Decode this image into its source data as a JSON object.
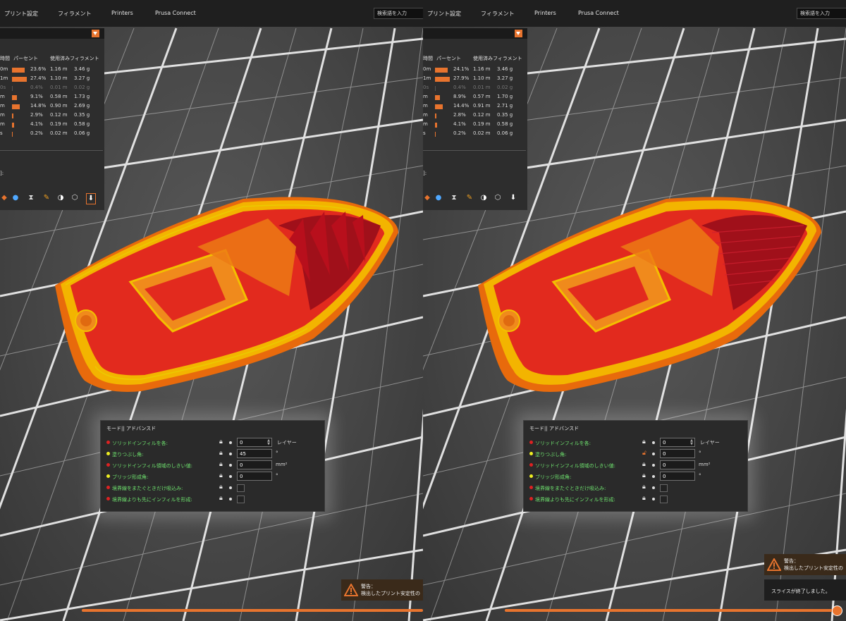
{
  "topbar": {
    "tabs": [
      "プリント設定",
      "フィラメント",
      "Printers",
      "Prusa Connect"
    ],
    "search_placeholder": "検索語を入力"
  },
  "colors": {
    "accent": "#e8742e",
    "label_green": "#6ee26e",
    "infill_red": "#e0202a",
    "perimeter_orange": "#f07a14"
  },
  "left": {
    "stats": {
      "headers": {
        "time": "時間",
        "percent": "パーセント",
        "filament": "使用済みフィラメント"
      },
      "rows": [
        {
          "time": "0m",
          "percent": "23.6%",
          "length": "1.16 m",
          "weight": "3.46 g",
          "bar": 0.236,
          "dim": false
        },
        {
          "time": "1m",
          "percent": "27.4%",
          "length": "1.10 m",
          "weight": "3.27 g",
          "bar": 0.274,
          "dim": false
        },
        {
          "time": "0s",
          "percent": "0.4%",
          "length": "0.01 m",
          "weight": "0.02 g",
          "bar": 0.004,
          "dim": true
        },
        {
          "time": "m",
          "percent": "9.1%",
          "length": "0.58 m",
          "weight": "1.73 g",
          "bar": 0.091,
          "dim": false
        },
        {
          "time": "m",
          "percent": "14.8%",
          "length": "0.90 m",
          "weight": "2.69 g",
          "bar": 0.148,
          "dim": false
        },
        {
          "time": "m",
          "percent": "2.9%",
          "length": "0.12 m",
          "weight": "0.35 g",
          "bar": 0.029,
          "dim": false
        },
        {
          "time": "m",
          "percent": "4.1%",
          "length": "0.19 m",
          "weight": "0.58 g",
          "bar": 0.041,
          "dim": false
        },
        {
          "time": "s",
          "percent": "0.2%",
          "length": "0.02 m",
          "weight": "0.06 g",
          "bar": 0.002,
          "dim": false
        }
      ],
      "footer_label": "]:"
    },
    "panel": {
      "title": "モード|| アドバンスド",
      "rows": [
        {
          "label": "ソリッドインフィルを各:",
          "dot": "#d22",
          "value": "0",
          "unit": "レイヤー",
          "type": "spin",
          "locked": true
        },
        {
          "label": "塗りつぶし角:",
          "dot": "#ee2",
          "value": "45",
          "unit": "°",
          "type": "input",
          "locked": true
        },
        {
          "label": "ソリッドインフィル領域のしきい値:",
          "dot": "#d22",
          "value": "0",
          "unit": "mm²",
          "type": "input",
          "locked": true
        },
        {
          "label": "ブリッジ形成角:",
          "dot": "#ee2",
          "value": "0",
          "unit": "°",
          "type": "input",
          "locked": true
        },
        {
          "label": "境界線をまたぐときだけ吸込み:",
          "dot": "#d22",
          "value": "",
          "unit": "",
          "type": "check",
          "locked": true
        },
        {
          "label": "境界線よりも先にインフィルを形成:",
          "dot": "#d22",
          "value": "",
          "unit": "",
          "type": "check",
          "locked": true
        }
      ]
    },
    "warning": {
      "title": "警告：",
      "text": "検出したプリント安定性の"
    }
  },
  "right": {
    "stats": {
      "headers": {
        "time": "時間",
        "percent": "パーセント",
        "filament": "使用済みフィラメント"
      },
      "rows": [
        {
          "time": "0m",
          "percent": "24.1%",
          "length": "1.16 m",
          "weight": "3.46 g",
          "bar": 0.241,
          "dim": false
        },
        {
          "time": "1m",
          "percent": "27.9%",
          "length": "1.10 m",
          "weight": "3.27 g",
          "bar": 0.279,
          "dim": false
        },
        {
          "time": "0s",
          "percent": "0.4%",
          "length": "0.01 m",
          "weight": "0.02 g",
          "bar": 0.004,
          "dim": true
        },
        {
          "time": "m",
          "percent": "8.9%",
          "length": "0.57 m",
          "weight": "1.70 g",
          "bar": 0.089,
          "dim": false
        },
        {
          "time": "m",
          "percent": "14.4%",
          "length": "0.91 m",
          "weight": "2.71 g",
          "bar": 0.144,
          "dim": false
        },
        {
          "time": "m",
          "percent": "2.8%",
          "length": "0.12 m",
          "weight": "0.35 g",
          "bar": 0.028,
          "dim": false
        },
        {
          "time": "m",
          "percent": "4.1%",
          "length": "0.19 m",
          "weight": "0.58 g",
          "bar": 0.041,
          "dim": false
        },
        {
          "time": "s",
          "percent": "0.2%",
          "length": "0.02 m",
          "weight": "0.06 g",
          "bar": 0.002,
          "dim": false
        }
      ],
      "footer_label": "]:"
    },
    "panel": {
      "title": "モード|| アドバンスド",
      "rows": [
        {
          "label": "ソリッドインフィルを各:",
          "dot": "#d22",
          "value": "0",
          "unit": "レイヤー",
          "type": "spin",
          "locked": true
        },
        {
          "label": "塗りつぶし角:",
          "dot": "#ee2",
          "value": "0",
          "unit": "°",
          "type": "input",
          "locked": false
        },
        {
          "label": "ソリッドインフィル領域のしきい値:",
          "dot": "#d22",
          "value": "0",
          "unit": "mm²",
          "type": "input",
          "locked": true
        },
        {
          "label": "ブリッジ形成角:",
          "dot": "#ee2",
          "value": "0",
          "unit": "°",
          "type": "input",
          "locked": true
        },
        {
          "label": "境界線をまたぐときだけ吸込み:",
          "dot": "#d22",
          "value": "",
          "unit": "",
          "type": "check",
          "locked": true
        },
        {
          "label": "境界線よりも先にインフィルを形成:",
          "dot": "#d22",
          "value": "",
          "unit": "",
          "type": "check",
          "locked": true
        }
      ]
    },
    "warning": {
      "title": "警告：",
      "text": "検出したプリント安定性の"
    },
    "slice_done": "スライスが終了しました。"
  }
}
